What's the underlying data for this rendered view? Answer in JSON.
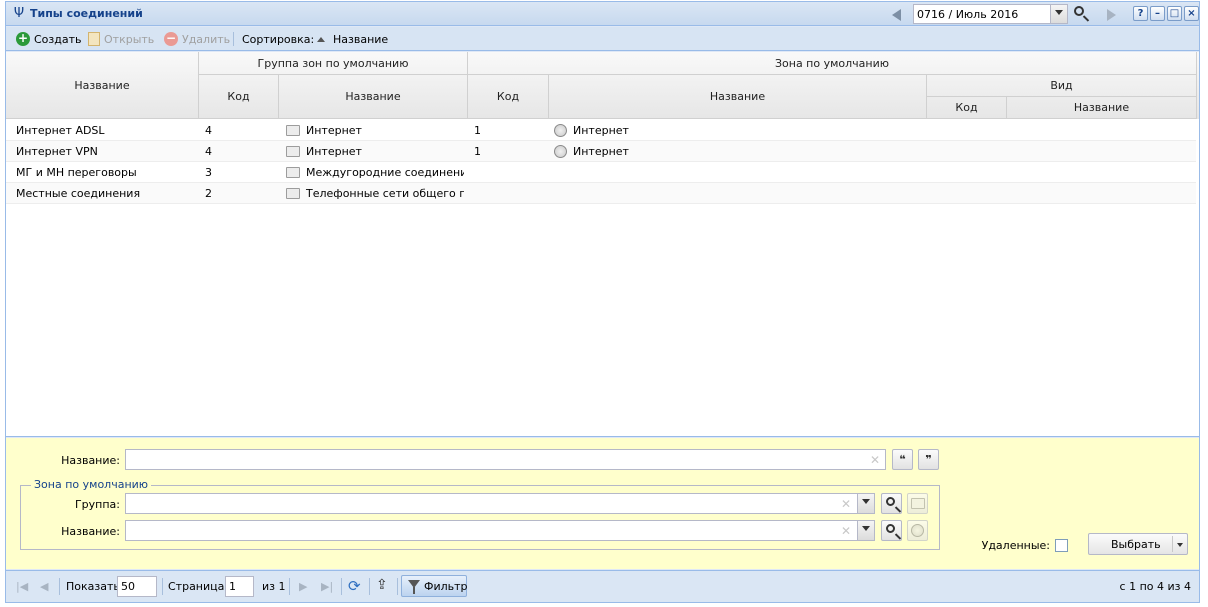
{
  "window": {
    "title": "Типы соединений",
    "period": "0716 / Июль 2016"
  },
  "toolbar": {
    "create": "Создать",
    "open": "Открыть",
    "delete": "Удалить",
    "sort_label": "Сортировка:",
    "sort_field": "Название"
  },
  "grid": {
    "headers": {
      "name": "Название",
      "zone_group": "Группа зон по умолчанию",
      "zone_group_code": "Код",
      "zone_group_name": "Название",
      "zone": "Зона по умолчанию",
      "zone_code": "Код",
      "zone_name": "Название",
      "kind": "Вид",
      "kind_code": "Код",
      "kind_name": "Название"
    },
    "rows": [
      {
        "name": "Интернет ADSL",
        "group_code": "4",
        "group_name": "Интернет",
        "zone_code": "1",
        "zone_name": "Интернет"
      },
      {
        "name": "Интернет VPN",
        "group_code": "4",
        "group_name": "Интернет",
        "zone_code": "1",
        "zone_name": "Интернет"
      },
      {
        "name": "МГ и МН переговоры",
        "group_code": "3",
        "group_name": "Междугородние соединения",
        "zone_code": "",
        "zone_name": ""
      },
      {
        "name": "Местные соединения",
        "group_code": "2",
        "group_name": "Телефонные сети общего по...",
        "zone_code": "",
        "zone_name": ""
      }
    ]
  },
  "filter": {
    "name_label": "Название:",
    "name_value": "",
    "fieldset_legend": "Зона по умолчанию",
    "group_label": "Группа:",
    "group_value": "",
    "zone_name_label": "Название:",
    "zone_name_value": "",
    "deleted_label": "Удаленные:",
    "select_button": "Выбрать",
    "quote_open": "❝",
    "quote_close": "❞"
  },
  "paging": {
    "show_label": "Показать",
    "page_size": "50",
    "page_label": "Страница",
    "page": "1",
    "of_label": "из 1",
    "filter_button": "Фильтр",
    "summary": "с 1 по 4 из 4"
  },
  "colors": {
    "accent": "#15428b",
    "filter_bg": "#ffffcc",
    "create": "#2c9a3a"
  }
}
